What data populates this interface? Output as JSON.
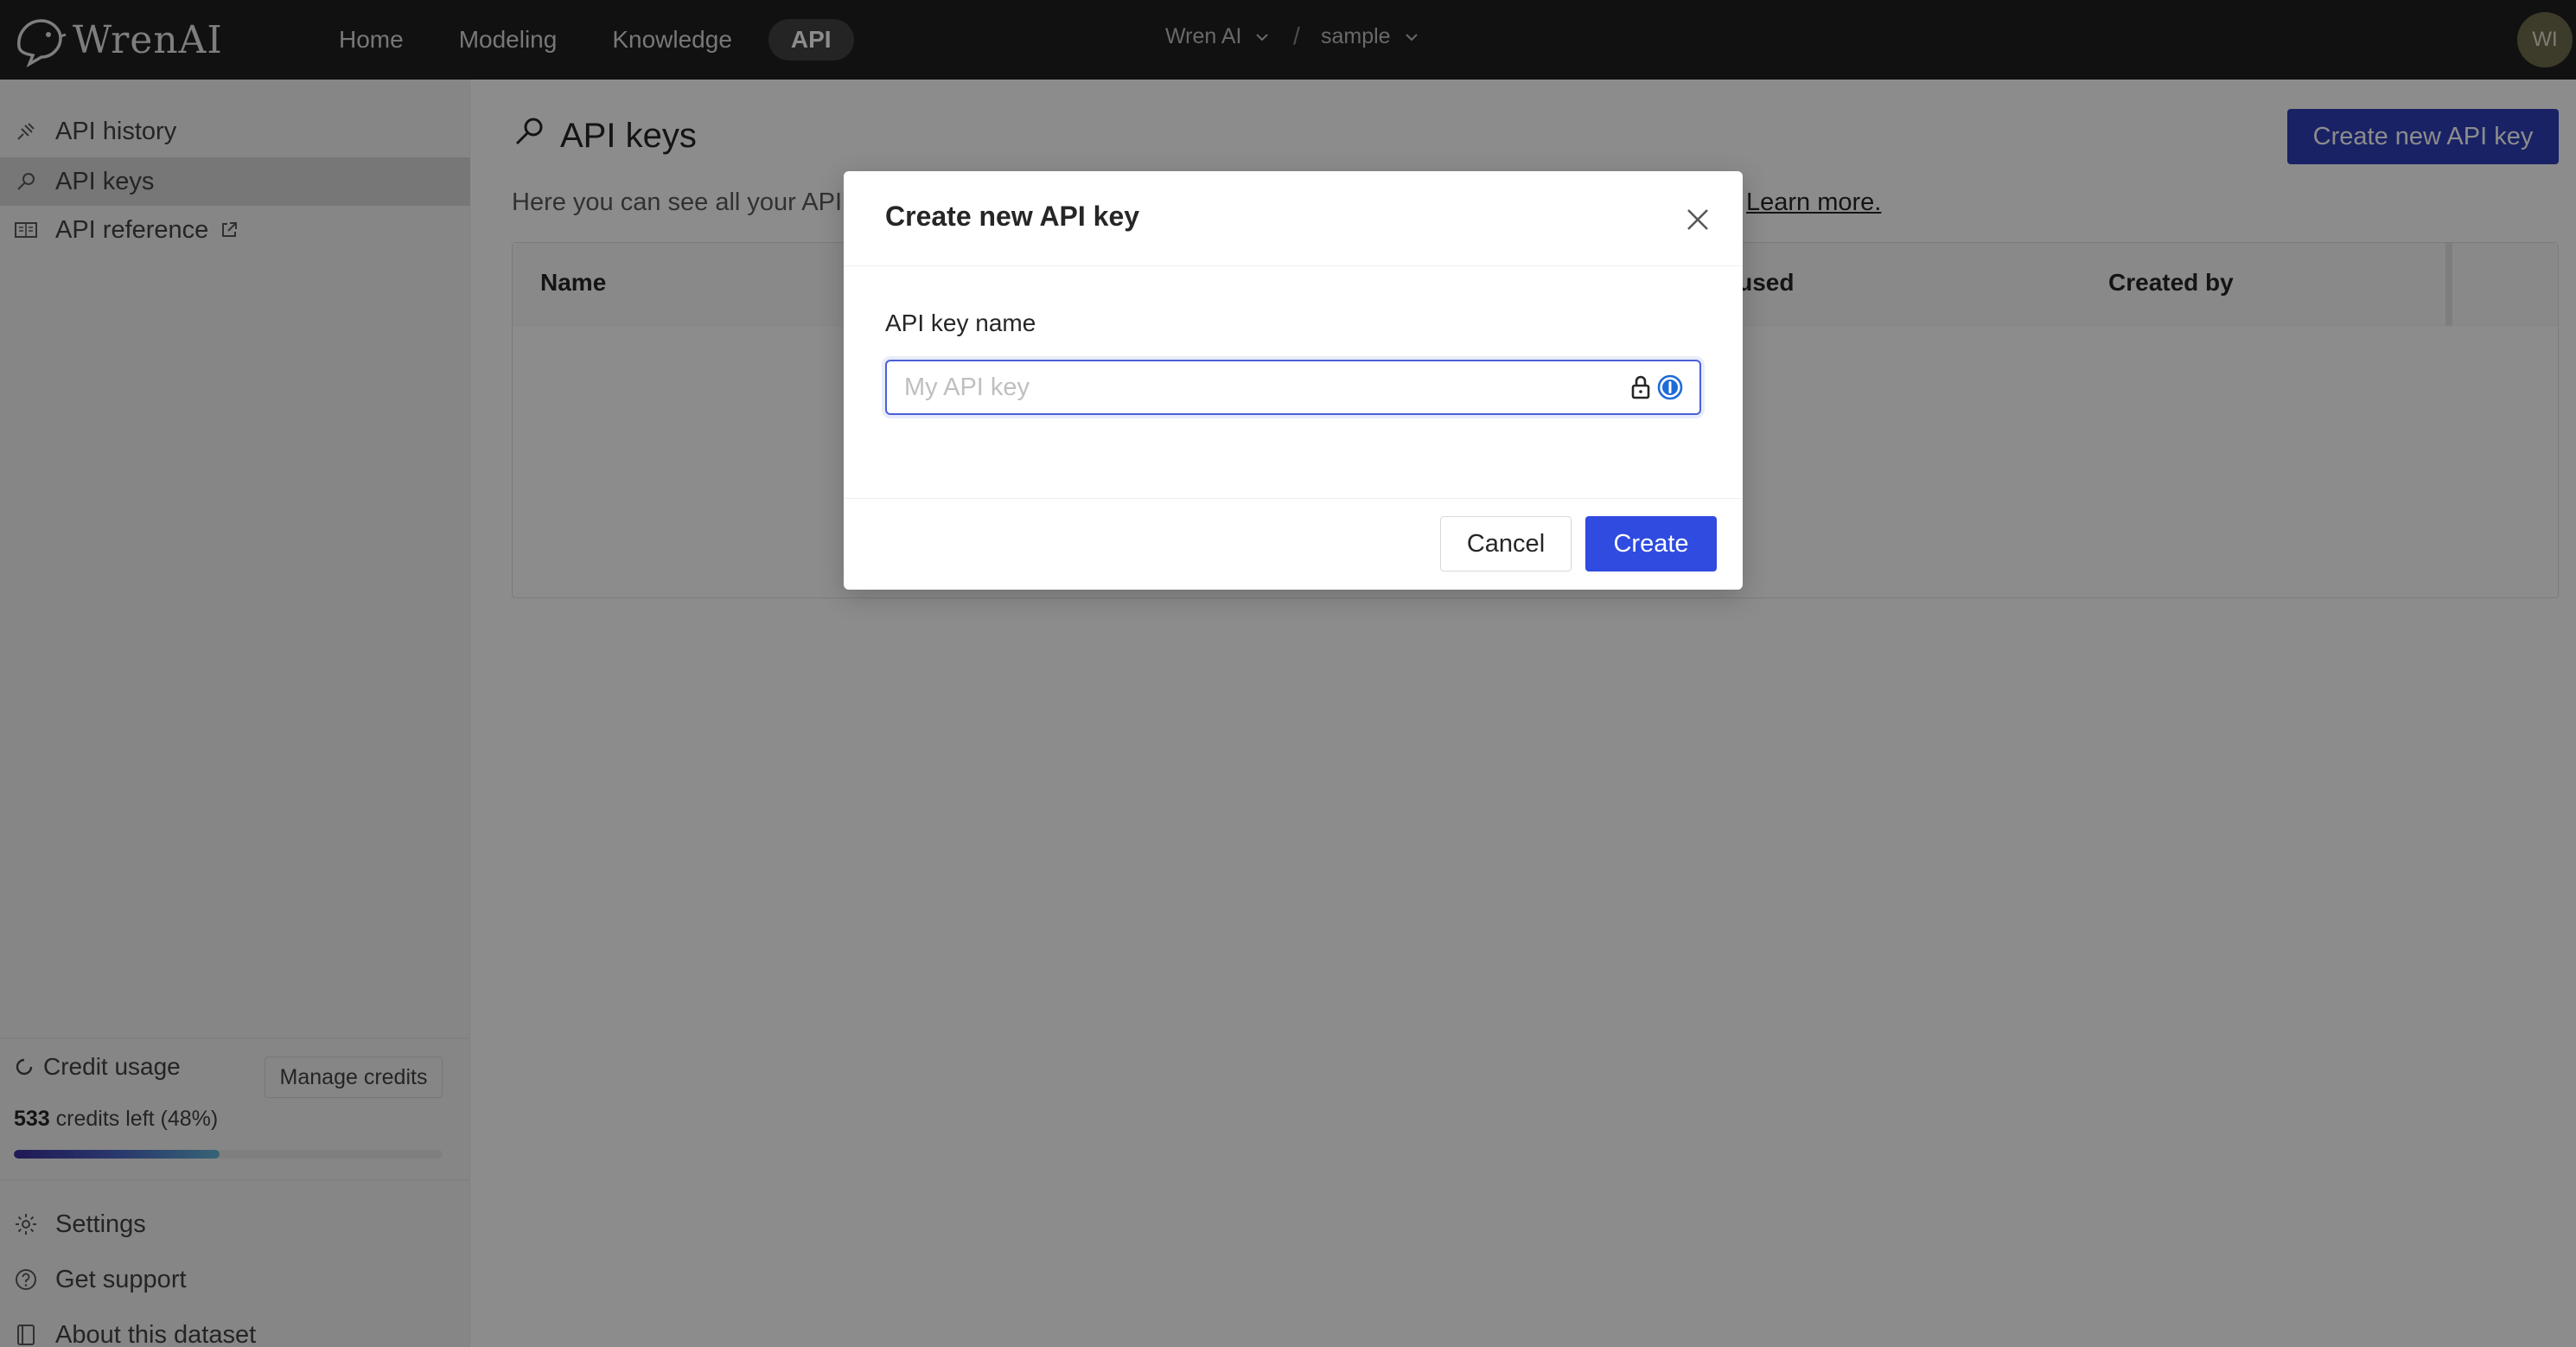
{
  "app": {
    "logo_text": "WrenAI",
    "nav": [
      {
        "label": "Home"
      },
      {
        "label": "Modeling"
      },
      {
        "label": "Knowledge"
      },
      {
        "label": "API",
        "active": true
      }
    ],
    "workspace": "Wren AI",
    "separator": "/",
    "project": "sample",
    "avatar_initials": "WI"
  },
  "sidebar": {
    "items": [
      {
        "label": "API history",
        "icon": "api-history-icon"
      },
      {
        "label": "API keys",
        "icon": "key-icon",
        "active": true
      },
      {
        "label": "API reference",
        "icon": "book-icon",
        "external": true
      }
    ],
    "credit_usage_label": "Credit usage",
    "manage_credits_label": "Manage credits",
    "credits_count": "533",
    "credits_suffix": "credits left (48%)",
    "credits_fraction": 0.48,
    "bottom_items": [
      {
        "label": "Settings",
        "icon": "gear-icon"
      },
      {
        "label": "Get support",
        "icon": "question-icon"
      },
      {
        "label": "About this dataset",
        "icon": "document-icon"
      }
    ]
  },
  "main": {
    "title": "API keys",
    "create_button_label": "Create new API key",
    "description_visible": "Here you can see all your API",
    "learn_more": "Learn more.",
    "table_headers": [
      "Name",
      "t used",
      "Created by"
    ]
  },
  "modal": {
    "title": "Create new API key",
    "field_label": "API key name",
    "field_placeholder": "My API key",
    "field_value": "",
    "cancel_label": "Cancel",
    "create_label": "Create"
  },
  "colors": {
    "topbar_bg": "#1f1f1f",
    "primary": "#2f4be0",
    "overlay": "rgba(0,0,0,0.45)"
  }
}
